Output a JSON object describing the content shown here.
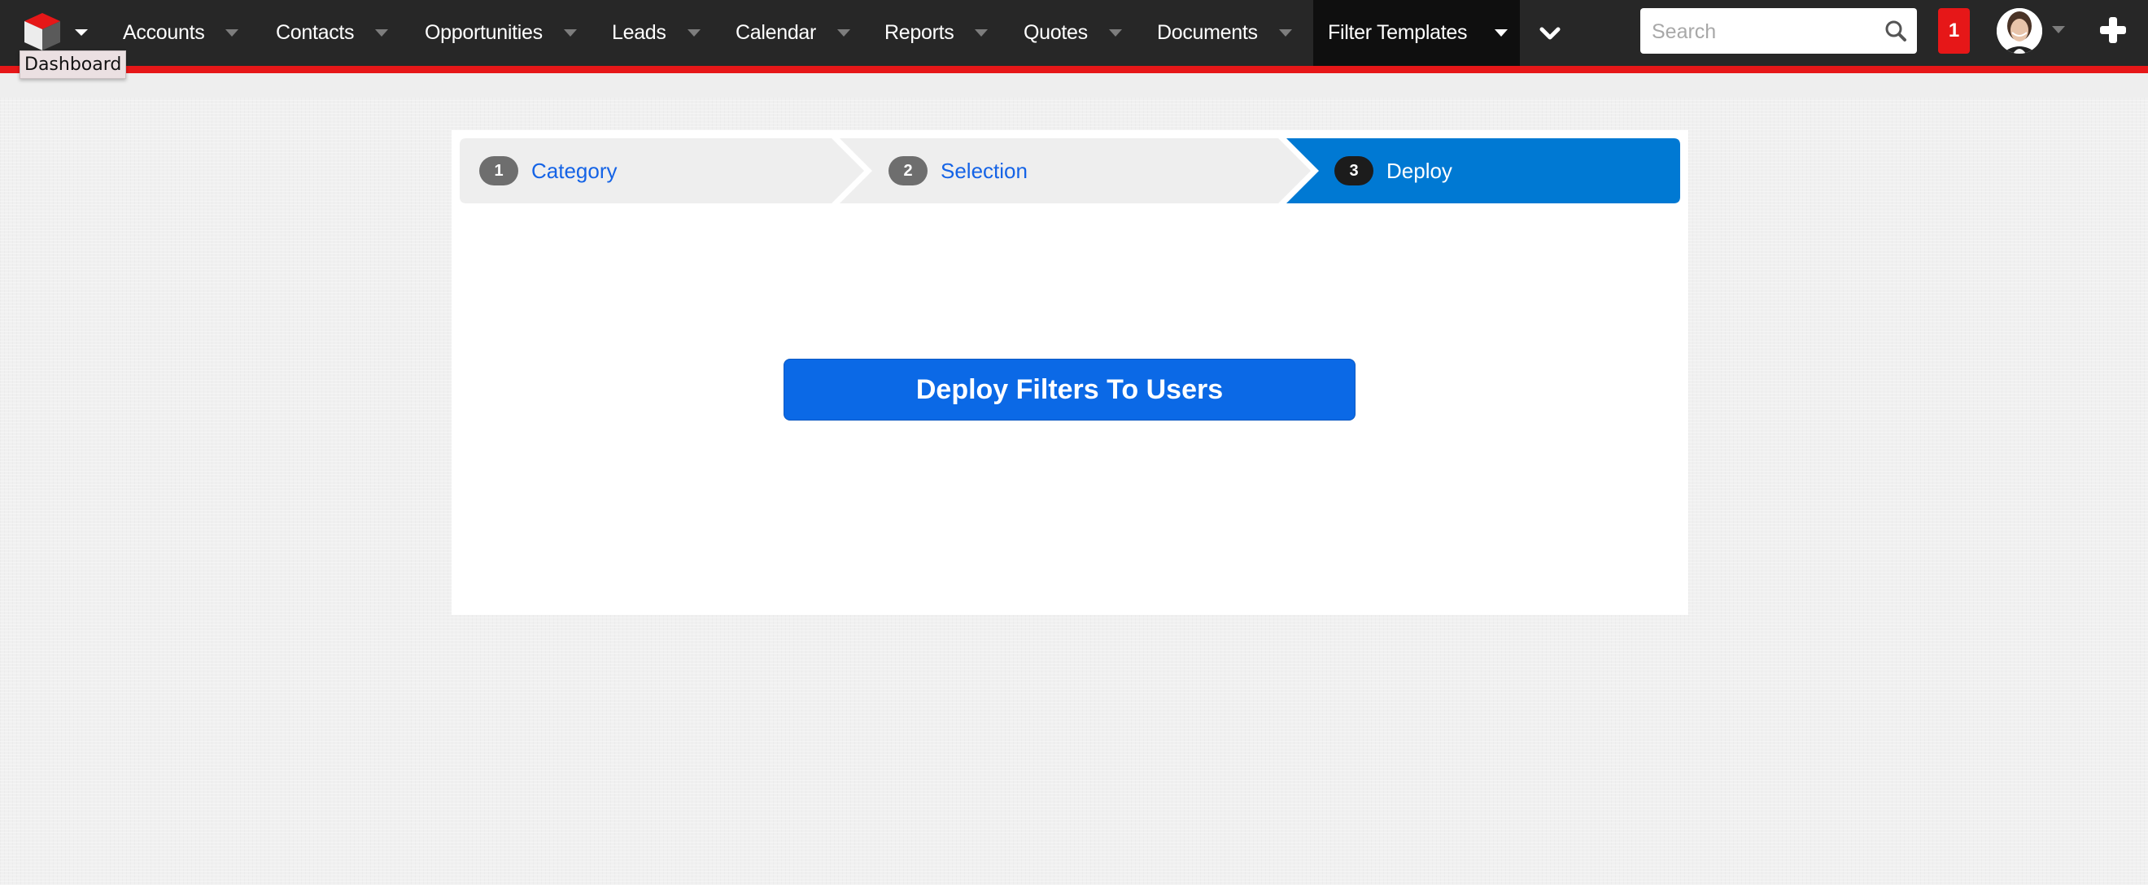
{
  "nav": {
    "logo_tooltip": "Dashboard",
    "items": [
      {
        "label": "Accounts"
      },
      {
        "label": "Contacts"
      },
      {
        "label": "Opportunities"
      },
      {
        "label": "Leads"
      },
      {
        "label": "Calendar"
      },
      {
        "label": "Reports"
      },
      {
        "label": "Quotes"
      },
      {
        "label": "Documents"
      },
      {
        "label": "Filter Templates",
        "active": true
      }
    ],
    "more_icon": "chevron-down-icon",
    "search": {
      "placeholder": "Search",
      "value": "",
      "icon": "search-icon"
    },
    "notification_count": "1",
    "avatar_icon": "user-avatar",
    "create_icon": "plus-icon"
  },
  "wizard": {
    "steps": [
      {
        "number": "1",
        "label": "Category",
        "state": "done"
      },
      {
        "number": "2",
        "label": "Selection",
        "state": "done"
      },
      {
        "number": "3",
        "label": "Deploy",
        "state": "current"
      }
    ],
    "action_button": "Deploy Filters To Users"
  },
  "colors": {
    "navbar": "#272727",
    "nav_active": "#0f0f0f",
    "brand_red": "#e61718",
    "step_inactive": "#eeeeee",
    "step_active": "#0079d3",
    "link_blue": "#1463e6",
    "primary_button": "#0b69e6"
  }
}
